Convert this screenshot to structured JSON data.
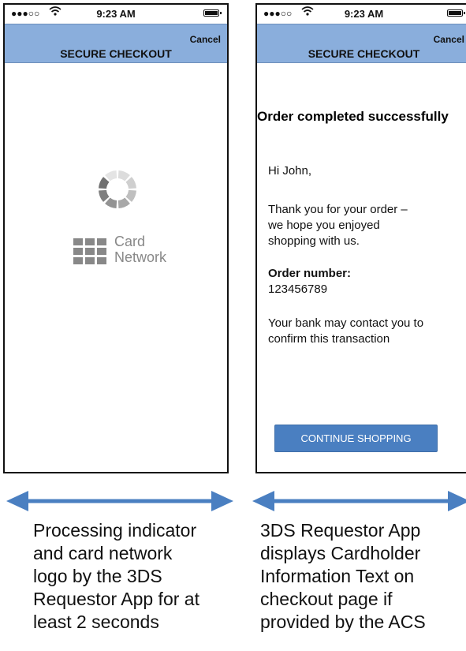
{
  "left_screen": {
    "status": {
      "time": "9:23 AM"
    },
    "header": {
      "cancel_label": "Cancel",
      "title": "SECURE CHECKOUT"
    },
    "logo": {
      "text": "Card\nNetwork"
    },
    "caption": "Processing indicator\nand card network\nlogo by the 3DS\nRequestor App for at\nleast 2 seconds"
  },
  "right_screen": {
    "status": {
      "time": "9:23 AM"
    },
    "header": {
      "cancel_label": "Cancel",
      "title": "SECURE CHECKOUT"
    },
    "order_title": "Order completed successfully",
    "greeting": "Hi John,",
    "thanks": "Thank you for your order –\nwe hope you enjoyed\nshopping with us.",
    "order_label": "Order number:",
    "order_number": "123456789",
    "bank_note": "Your bank may contact you to\nconfirm this transaction",
    "continue_label": "CONTINUE SHOPPING",
    "caption": "3DS Requestor App\ndisplays Cardholder\nInformation Text on\ncheckout page if\nprovided by the ACS"
  },
  "colors": {
    "header_bg": "#8aaedc",
    "button_bg": "#4a7fc1",
    "arrow": "#4a7fc1",
    "spinner": "#7f7f7f",
    "logo_grey": "#888888"
  },
  "icons": {
    "signal": "signal-dots-icon",
    "wifi": "wifi-icon",
    "battery": "battery-icon",
    "spinner": "loading-spinner-icon",
    "logo_grid": "card-network-grid-icon",
    "arrow": "double-arrow-icon"
  }
}
